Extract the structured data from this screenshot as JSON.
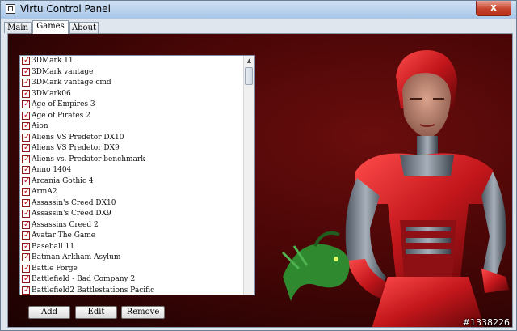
{
  "window": {
    "title": "Virtu Control Panel",
    "close_glyph": "x"
  },
  "tabs": [
    {
      "label": "Main",
      "active": false
    },
    {
      "label": "Games",
      "active": true
    },
    {
      "label": "About",
      "active": false
    }
  ],
  "games_list": {
    "items": [
      {
        "label": "3DMark 11",
        "checked": true
      },
      {
        "label": "3DMark vantage",
        "checked": true
      },
      {
        "label": "3DMark vantage cmd",
        "checked": true
      },
      {
        "label": "3DMark06",
        "checked": true
      },
      {
        "label": "Age of Empires 3",
        "checked": true
      },
      {
        "label": "Age of Pirates 2",
        "checked": true
      },
      {
        "label": "Aion",
        "checked": true
      },
      {
        "label": "Aliens VS Predetor DX10",
        "checked": true
      },
      {
        "label": "Aliens VS Predetor DX9",
        "checked": true
      },
      {
        "label": "Aliens vs. Predator benchmark",
        "checked": true
      },
      {
        "label": "Anno 1404",
        "checked": true
      },
      {
        "label": "Arcania Gothic 4",
        "checked": true
      },
      {
        "label": "ArmA2",
        "checked": true
      },
      {
        "label": "Assassin's Creed DX10",
        "checked": true
      },
      {
        "label": "Assassin's Creed DX9",
        "checked": true
      },
      {
        "label": "Assassins Creed 2",
        "checked": true
      },
      {
        "label": "Avatar The Game",
        "checked": true
      },
      {
        "label": "Baseball 11",
        "checked": true
      },
      {
        "label": "Batman Arkham Asylum",
        "checked": true
      },
      {
        "label": "Battle Forge",
        "checked": true
      },
      {
        "label": "Battlefield - Bad Company 2",
        "checked": true
      },
      {
        "label": "Battlefield2 Battlestations Pacific",
        "checked": true
      }
    ],
    "scroll_up_glyph": "▲",
    "check_glyph": "✓"
  },
  "buttons": {
    "add": "Add",
    "edit": "Edit",
    "remove": "Remove"
  },
  "watermark": "#1338226",
  "colors": {
    "background_red": "#4a0606",
    "checkbox_red": "#c0161b"
  }
}
